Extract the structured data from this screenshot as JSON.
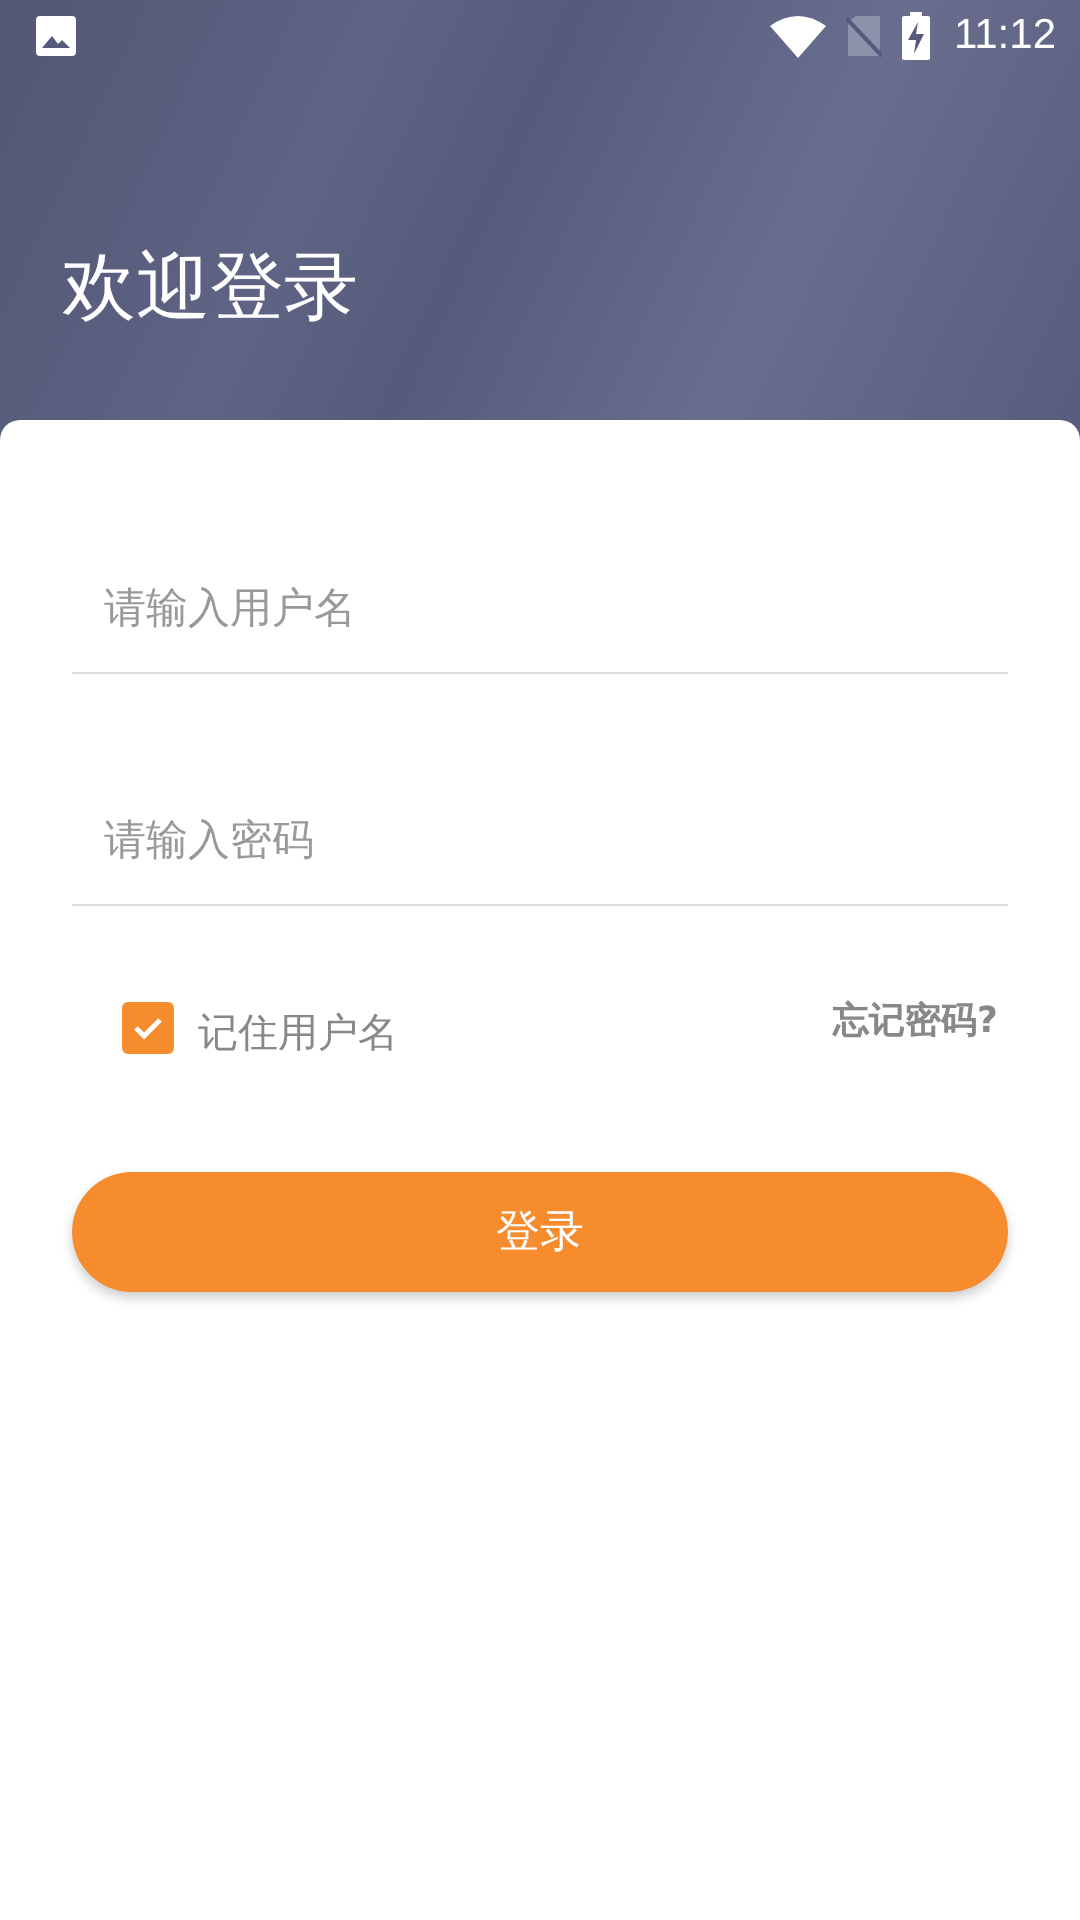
{
  "status_bar": {
    "time": "11:12"
  },
  "header": {
    "title": "欢迎登录"
  },
  "form": {
    "username": {
      "placeholder": "请输入用户名"
    },
    "password": {
      "placeholder": "请输入密码"
    },
    "remember": {
      "label": "记住用户名",
      "checked": true
    },
    "forgot_link": "忘记密码?",
    "login_button": "登录"
  }
}
